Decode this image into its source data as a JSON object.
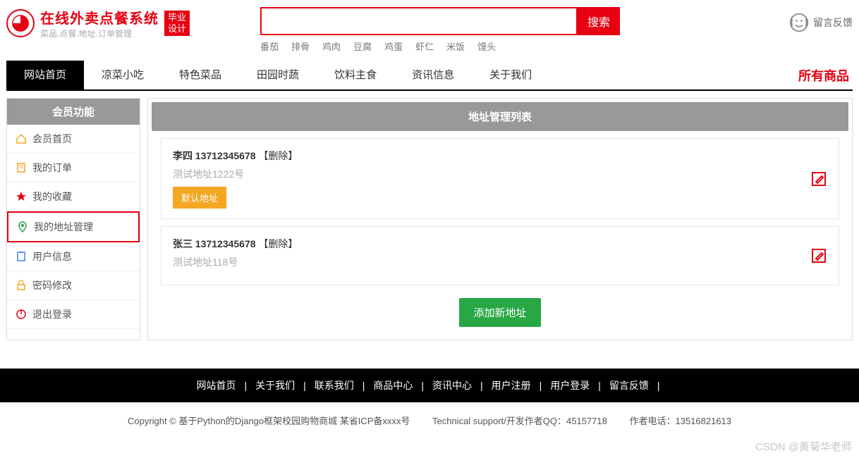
{
  "header": {
    "logoMain": "在线外卖点餐系统",
    "logoSub": "菜品.点餐.地址.订单管理",
    "badgeLine1": "毕业",
    "badgeLine2": "设计",
    "searchBtn": "搜索",
    "searchPlaceholder": "",
    "keywords": [
      "番茄",
      "排骨",
      "鸡肉",
      "豆腐",
      "鸡蛋",
      "虾仁",
      "米饭",
      "馒头"
    ],
    "feedback": "留言反馈"
  },
  "nav": {
    "items": [
      "网站首页",
      "凉菜小吃",
      "特色菜品",
      "田园时蔬",
      "饮料主食",
      "资讯信息",
      "关于我们"
    ],
    "right": "所有商品",
    "activeIndex": 0
  },
  "sidebar": {
    "header": "会员功能",
    "items": [
      {
        "label": "会员首页",
        "icon": "home",
        "color": "#f5a623"
      },
      {
        "label": "我的订单",
        "icon": "doc",
        "color": "#f5a623"
      },
      {
        "label": "我的收藏",
        "icon": "star",
        "color": "#e60012"
      },
      {
        "label": "我的地址管理",
        "icon": "pin",
        "color": "#28a745",
        "selected": true
      },
      {
        "label": "用户信息",
        "icon": "clipboard",
        "color": "#3b82f6"
      },
      {
        "label": "密码修改",
        "icon": "lock",
        "color": "#f5a623"
      },
      {
        "label": "退出登录",
        "icon": "power",
        "color": "#e60012"
      }
    ]
  },
  "main": {
    "header": "地址管理列表",
    "addresses": [
      {
        "name": "李四",
        "phone": "13712345678",
        "delLabel": "【删除】",
        "desc": "测试地址1222号",
        "default": true,
        "defaultLabel": "默认地址"
      },
      {
        "name": "张三",
        "phone": "13712345678",
        "delLabel": "【删除】",
        "desc": "测试地址118号",
        "default": false
      }
    ],
    "addBtn": "添加新地址"
  },
  "footer": {
    "links": [
      "网站首页",
      "关于我们",
      "联系我们",
      "商品中心",
      "资讯中心",
      "用户注册",
      "用户登录",
      "留言反馈"
    ],
    "info": {
      "copyright": "Copyright © 基于Python的Django框架校园购物商城 某省ICP备xxxx号",
      "tech": "Technical support/开发作者QQ：45157718",
      "phone": "作者电话：13516821613"
    }
  },
  "watermark": "CSDN @黄菊华老师"
}
